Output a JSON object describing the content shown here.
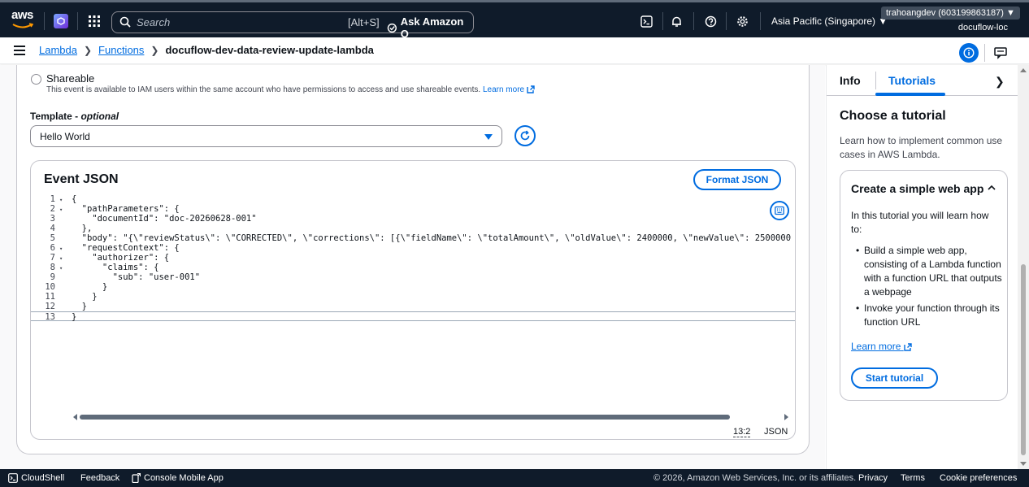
{
  "topnav": {
    "logo_text": "aws",
    "search_placeholder": "Search",
    "search_shortcut": "[Alt+S]",
    "ask_q_label": "Ask Amazon Q",
    "region_label": "Asia Pacific (Singapore) ▼",
    "account_label": "trahoangdev (603199863187) ▼",
    "account_sub": "docuflow-loc"
  },
  "breadcrumb": {
    "items": [
      "Lambda",
      "Functions"
    ],
    "current": "docuflow-dev-data-review-update-lambda"
  },
  "shareable": {
    "label": "Shareable",
    "description": "This event is available to IAM users within the same account who have permissions to access and use shareable events.",
    "learn_more": "Learn more"
  },
  "template": {
    "label": "Template",
    "optional": "optional",
    "value": "Hello World"
  },
  "editor": {
    "title": "Event JSON",
    "format_button": "Format JSON",
    "cursor_position": "13:2",
    "language": "JSON",
    "lines": [
      {
        "n": "1",
        "fold": true,
        "text": "{"
      },
      {
        "n": "2",
        "fold": true,
        "text": "  \"pathParameters\": {"
      },
      {
        "n": "3",
        "fold": false,
        "text": "    \"documentId\": \"doc-20260628-001\""
      },
      {
        "n": "4",
        "fold": false,
        "text": "  },"
      },
      {
        "n": "5",
        "fold": false,
        "text": "  \"body\": \"{\\\"reviewStatus\\\": \\\"CORRECTED\\\", \\\"corrections\\\": [{\\\"fieldName\\\": \\\"totalAmount\\\", \\\"oldValue\\\": 2400000, \\\"newValue\\\": 2500000"
      },
      {
        "n": "6",
        "fold": true,
        "text": "  \"requestContext\": {"
      },
      {
        "n": "7",
        "fold": true,
        "text": "    \"authorizer\": {"
      },
      {
        "n": "8",
        "fold": true,
        "text": "      \"claims\": {"
      },
      {
        "n": "9",
        "fold": false,
        "text": "        \"sub\": \"user-001\""
      },
      {
        "n": "10",
        "fold": false,
        "text": "      }"
      },
      {
        "n": "11",
        "fold": false,
        "text": "    }"
      },
      {
        "n": "12",
        "fold": false,
        "text": "  }"
      },
      {
        "n": "13",
        "fold": false,
        "text": "}"
      }
    ]
  },
  "right_panel": {
    "tab_info": "Info",
    "tab_tutorials": "Tutorials",
    "heading": "Choose a tutorial",
    "intro": "Learn how to implement common use cases in AWS Lambda.",
    "tutorial": {
      "title": "Create a simple web app",
      "intro": "In this tutorial you will learn how to:",
      "bullets": [
        "Build a simple web app, consisting of a Lambda function with a function URL that outputs a webpage",
        "Invoke your function through its function URL"
      ],
      "learn_more": "Learn more",
      "start_button": "Start tutorial"
    }
  },
  "footer": {
    "cloudshell": "CloudShell",
    "feedback": "Feedback",
    "mobile_app": "Console Mobile App",
    "copyright": "© 2026, Amazon Web Services, Inc. or its affiliates.",
    "privacy": "Privacy",
    "terms": "Terms",
    "cookie": "Cookie preferences"
  },
  "colors": {
    "nav_bg": "#0f1b2a",
    "link": "#006ce0",
    "text": "#0f141a"
  }
}
